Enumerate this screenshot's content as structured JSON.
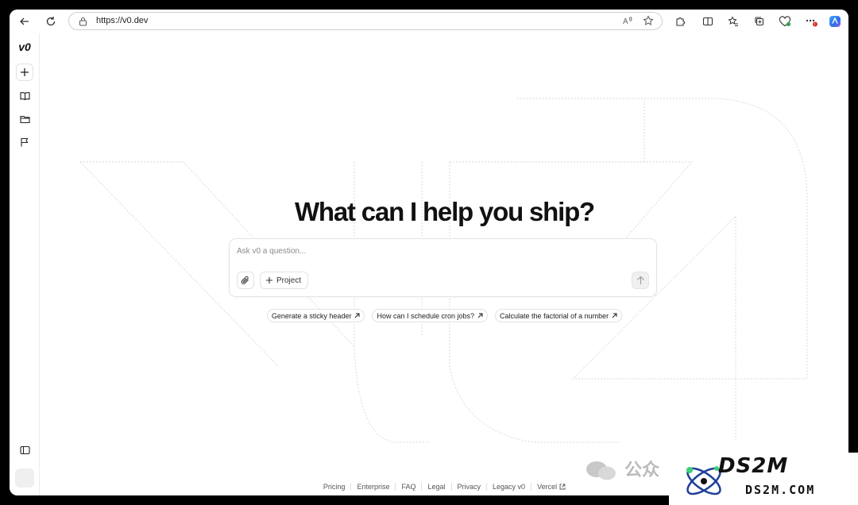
{
  "browser": {
    "url": "https://v0.dev"
  },
  "sidebar": {
    "logo": "v0"
  },
  "main": {
    "headline": "What can I help you ship?",
    "prompt_placeholder": "Ask v0 a question...",
    "project_label": "Project",
    "suggestions": [
      "Generate a sticky header",
      "How can I schedule cron jobs?",
      "Calculate the factorial of a number"
    ]
  },
  "footer": {
    "links": [
      "Pricing",
      "Enterprise",
      "FAQ",
      "Legal",
      "Privacy",
      "Legacy v0",
      "Vercel"
    ]
  },
  "watermark": {
    "wechat_label": "公众",
    "brand": "DS2M",
    "domain": "DS2M.COM"
  },
  "colors": {
    "accent": "#2f7be5",
    "badge": "#d93025",
    "text": "#111111"
  }
}
